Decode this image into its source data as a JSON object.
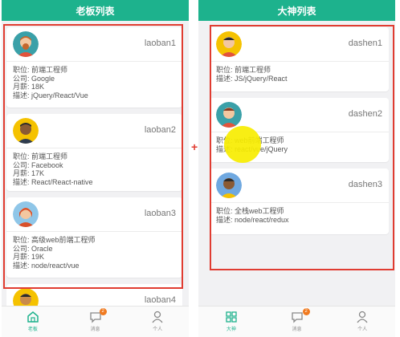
{
  "left_screen": {
    "title": "老板列表",
    "cards": [
      {
        "username": "laoban1",
        "fields": [
          "职位: 前端工程师",
          "公司: Google",
          "月薪: 18K",
          "描述: jQuery/React/Vue"
        ]
      },
      {
        "username": "laoban2",
        "fields": [
          "职位: 前端工程师",
          "公司: Facebook",
          "月薪: 17K",
          "描述: React/React-native"
        ]
      },
      {
        "username": "laoban3",
        "fields": [
          "职位: 高级web前端工程师",
          "公司: Oracle",
          "月薪: 19K",
          "描述: node/react/vue"
        ]
      },
      {
        "username": "laoban4",
        "fields": []
      }
    ],
    "tabs": [
      {
        "label": "老板",
        "icon": "home-icon",
        "active": true
      },
      {
        "label": "消息",
        "icon": "message-icon",
        "badge": "2"
      },
      {
        "label": "个人",
        "icon": "person-icon"
      }
    ]
  },
  "right_screen": {
    "title": "大神列表",
    "cards": [
      {
        "username": "dashen1",
        "fields": [
          "职位: 前端工程师",
          "描述: JS/jQuery/React"
        ]
      },
      {
        "username": "dashen2",
        "fields": [
          "职位: web前端工程师",
          "描述: react/vue/jQuery"
        ]
      },
      {
        "username": "dashen3",
        "fields": [
          "职位: 全栈web工程师",
          "描述: node/react/redux"
        ]
      }
    ],
    "tabs": [
      {
        "label": "大神",
        "icon": "grid-icon",
        "active": true
      },
      {
        "label": "消息",
        "icon": "message-icon",
        "badge": "2"
      },
      {
        "label": "个人",
        "icon": "person-icon"
      }
    ]
  },
  "annotation": {
    "plus": "+"
  },
  "colors": {
    "accent": "#1db28d",
    "highlight_box": "#e03c31",
    "badge": "#f07a20",
    "cursor": "#f7ed00"
  }
}
